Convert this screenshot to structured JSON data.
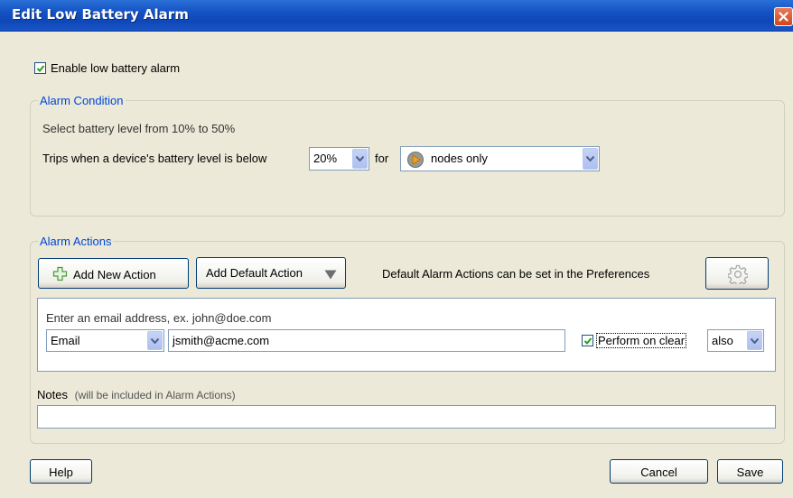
{
  "window": {
    "title": "Edit Low Battery Alarm"
  },
  "enable_alarm": {
    "label": "Enable low battery alarm",
    "checked": true
  },
  "alarm_condition": {
    "legend": "Alarm Condition",
    "hint": "Select battery level from 10% to 50%",
    "trip_label": "Trips when a device's battery level is below",
    "level_value": "20%",
    "for_label": "for",
    "target_value": "nodes only",
    "target_icon": "node-play-icon"
  },
  "alarm_actions": {
    "legend": "Alarm Actions",
    "add_new_label": "Add New Action",
    "add_default_label": "Add Default Action",
    "preferences_hint": "Default Alarm Actions can be set in the Preferences",
    "action": {
      "hint": "Enter an email address, ex. john@doe.com",
      "type_value": "Email",
      "address_value": "jsmith@acme.com",
      "perform_on_clear_label": "Perform on clear",
      "perform_on_clear_checked": true,
      "clear_mode_value": "also"
    },
    "notes_label": "Notes",
    "notes_sub": "(will be included in Alarm Actions)",
    "notes_value": ""
  },
  "footer": {
    "help_label": "Help",
    "cancel_label": "Cancel",
    "save_label": "Save"
  },
  "colors": {
    "title_bar": "#1452c4",
    "legend_text": "#0046d5",
    "dialog_bg": "#ece9d8",
    "checkmark": "#21a121"
  }
}
